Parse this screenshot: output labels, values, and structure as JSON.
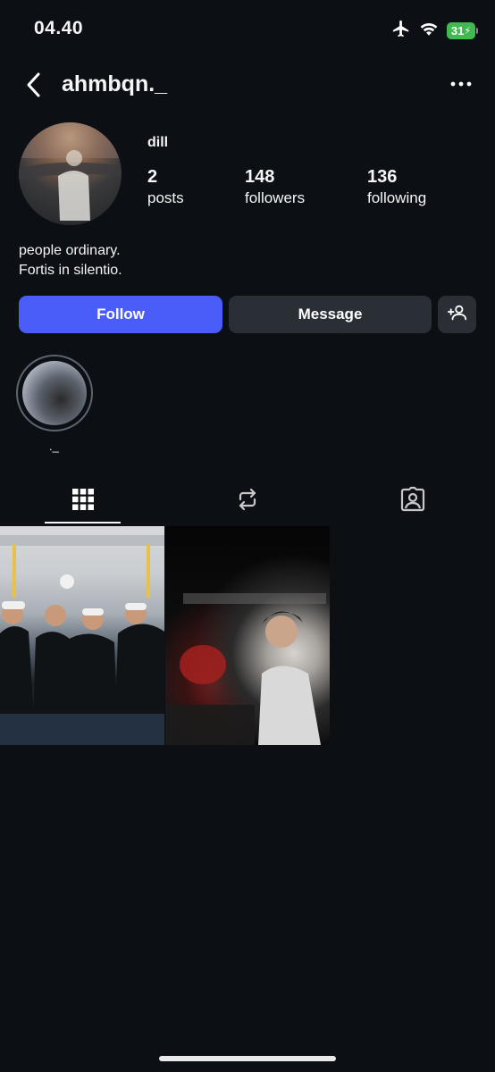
{
  "status_bar": {
    "time": "04.40",
    "battery": "31",
    "icons": [
      "airplane-icon",
      "wifi-icon",
      "battery-charging-icon"
    ]
  },
  "header": {
    "username": "ahmbqn._",
    "icons": [
      "back-chevron-icon",
      "more-dots-icon"
    ]
  },
  "profile": {
    "display_name": "dill",
    "stats": [
      {
        "value": "2",
        "label": "posts"
      },
      {
        "value": "148",
        "label": "followers"
      },
      {
        "value": "136",
        "label": "following"
      }
    ],
    "bio": [
      "people ordinary.",
      "Fortis in silentio."
    ]
  },
  "actions": {
    "follow_label": "Follow",
    "message_label": "Message",
    "suggest_icon": "add-person-icon"
  },
  "highlight": {
    "label": "._"
  },
  "tabs": [
    {
      "name": "grid",
      "icon": "grid-icon",
      "active": true
    },
    {
      "name": "reels",
      "icon": "repost-icon",
      "active": false
    },
    {
      "name": "tagged",
      "icon": "tagged-person-icon",
      "active": false
    }
  ],
  "posts_count": 2,
  "colors": {
    "background": "#0c1014",
    "follow_button": "#4a5df9",
    "secondary_button": "#2a2f36",
    "battery": "#3fb950"
  }
}
